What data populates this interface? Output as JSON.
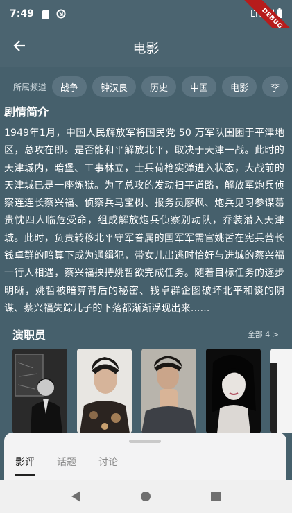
{
  "status_bar": {
    "time": "7:49",
    "network": "LTE",
    "debug_label": "DEBUG"
  },
  "app_bar": {
    "title": "电影",
    "back_icon": "arrow-left-icon"
  },
  "channels": {
    "label": "所属频道",
    "items": [
      "战争",
      "钟汉良",
      "历史",
      "中国",
      "电影",
      "李"
    ]
  },
  "synopsis": {
    "title": "剧情简介",
    "text": "1949年1月，中国人民解放军将国民党 50 万军队围困于平津地区，总攻在即。是否能和平解放北平，取决于天津一战。此时的天津城内，暗堡、工事林立，士兵荷枪实弹进入状态，大战前的天津城已是一座炼狱。为了总攻的发动扫平道路，解放军炮兵侦察连连长蔡兴福、侦察兵马宝树、报务员廖枫、炮兵见习参谋葛贵忱四人临危受命，组成解放炮兵侦察别动队，乔装潜入天津城。此时，负责转移北平守军眷属的国军军需官姚哲在宪兵营长钱卓群的暗算下成为通缉犯，带女儿出逃时恰好与进城的蔡兴福一行人相遇，蔡兴福挟持姚哲欲完成任务。随着目标任务的逐步明晰，姚哲被暗算背后的秘密、钱卓群企图破坏北平和谈的阴谋、蔡兴福失踪儿子的下落都渐渐浮现出来......"
  },
  "cast": {
    "title": "演职员",
    "all_label": "全部 4 >",
    "photos": [
      "cast-photo-1",
      "cast-photo-2",
      "cast-photo-3",
      "cast-photo-4",
      "cast-photo-5"
    ]
  },
  "sheet": {
    "tabs": [
      {
        "label": "影评",
        "active": true
      },
      {
        "label": "话题",
        "active": false
      },
      {
        "label": "讨论",
        "active": false
      }
    ]
  },
  "colors": {
    "background": "#46606c",
    "app_bar": "#4b6470",
    "chip": "#5b7380",
    "sheet": "#f3f3f4"
  }
}
